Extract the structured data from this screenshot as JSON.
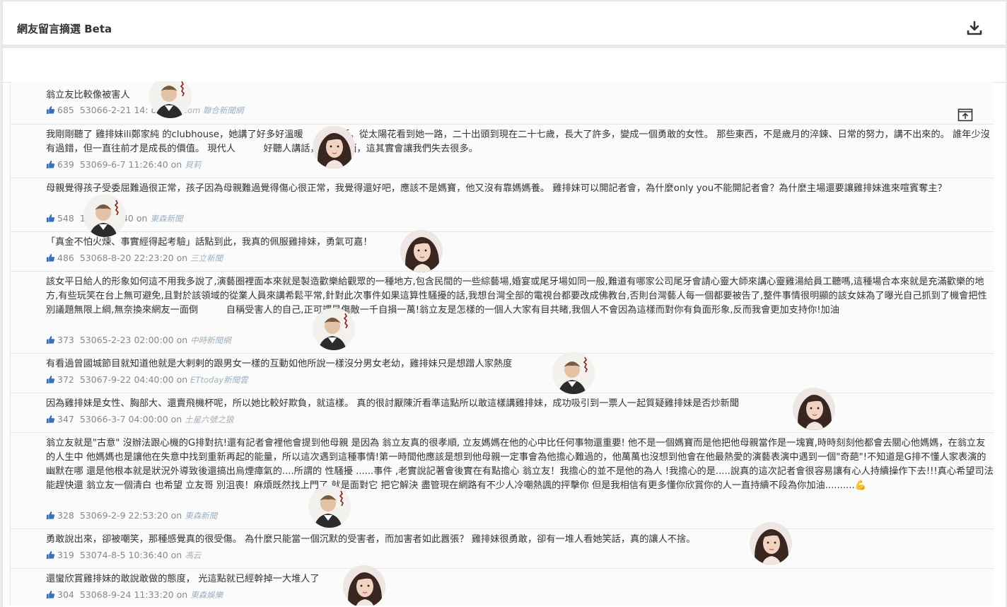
{
  "header": {
    "title": "網友留言摘選 Beta",
    "download_icon": "download-icon"
  },
  "comments": [
    {
      "text": "翁立友比較像被害人",
      "likes": "685",
      "time": "53066-2-21 14:",
      "on": "on",
      "source": "udn.com 聯合新聞網",
      "avatar": "man"
    },
    {
      "text": "我剛剛聽了 雞排妹ili鄭家純 的clubhouse，她講了好多好溫暖　　　的話。從太陽花看到她一路，二十出頭到現在二十七歲，長大了許多，變成一個勇敢的女性。 那些東西，不是歲月的淬鍊、日常的努力，講不出來的。 誰年少沒有過錯，但一直往前才是成長的價值。 現代人　　　好聽人講話，只求片面，這其實會讓我們失去很多。",
      "likes": "639",
      "time": "53069-6-7 11:26:40",
      "on": "on",
      "source": "貝莉",
      "avatar": "woman"
    },
    {
      "text": "母親覺得孩子受委屈難過很正常，孩子因為母親難過覺得傷心很正常，我覺得還好吧，應該不是媽寶，他又沒有靠媽媽養。 雞排妹可以開記者會，為什麼only you不能開記者會？為什麼主場還要讓雞排妹進來喧賓奪主？",
      "likes": "548",
      "time": "16 23:46:40",
      "on": "on",
      "source": "東森新聞",
      "avatar": "man"
    },
    {
      "text": "「真金不怕火煉、事實經得起考驗」話點到此，我真的佩服雞排妹，勇氣可嘉！",
      "likes": "486",
      "time": "53068-8-20 22:23:20",
      "on": "on",
      "source": "三立新聞",
      "avatar": "woman"
    },
    {
      "text": "該女平日給人的形象如何這不用我多說了,演藝圈裡面本來就是製造歡樂給觀眾的一種地方,包含民間的一些綜藝場,婚宴或尾牙場如同一般,難道有哪家公司尾牙會請心靈大師來講心靈雞湯給員工聽嗎,這種場合本來就是充滿歡樂的地方,有些玩笑在台上無可避免,且對於該領域的從業人員來講希鬆平常,針對此次事件如果這算性騷擾的話,我想台灣全部的電視台都要改成佛教台,否則台灣藝人每一個都要被告了,整件事情很明顯的該女妹為了曝光自己抓到了機會把性別議題無限上綱,無奈換來網友一面倒　　　自稱受害人的自己,正可謂是傷敵一千自損一萬!翁立友是怎樣的一個人大家有目共睹,我個人不會因為這樣而對你有負面形象,反而我會更加支持你!加油",
      "likes": "373",
      "time": "53065-2-23 02:00:00",
      "on": "on",
      "source": "中時新聞網",
      "avatar": "man"
    },
    {
      "text": "有看過曾國城節目就知道他就是大剌剌的跟男女一樣的互動如他所說一樣沒分男女老幼，雞排妹只是想蹭人家熱度",
      "likes": "372",
      "time": "53067-9-22 04:40:00",
      "on": "on",
      "source": "ETtoday新聞雲",
      "avatar": "man"
    },
    {
      "text": "因為雞排妹是女性、胸部大、還賣飛機杯呢，所以她比較好欺負，就這樣。 真的很討厭陳沂看準這點所以敢這樣講雞排妹，成功吸引到一票人一起質疑雞排妹是否炒新聞",
      "likes": "347",
      "time": "53066-3-7 04:00:00",
      "on": "on",
      "source": "土星六號之狼",
      "avatar": "woman"
    },
    {
      "text": "翁立友就是\"古意\" 沒辦法跟心機的G排對抗!還有記者會裡他會提到他母親 是因為 翁立友真的很孝順, 立友媽媽在他的心中比任何事物還重要! 他不是一個媽寶而是他把他母親當作是一塊寶,時時刻刻他都會去關心他媽媽，在翁立友的人生中 他媽媽也是讓他在失意中找到重新再起的能量，所以這次遇到這種事情!第一時間他應該是想到他母親一定事會為他擔心難過的，他萬萬也沒想到他會在他最熱愛的演藝表演中遇到一個\"奇葩\"!不知道是G排不懂人家表演的幽默在哪 還是他根本就是狀況外導致後還搞出烏煙瘴氣的....所謂的 性騷擾 ......事件 ,老實說記著會後實在有點擔心 翁立友！我擔心的並不是他的為人 !我擔心的是.....說真的這次記者會很容易讓有心人持續操作下去!!!真心希望司法能趕快還 翁立友一個清白 也希望 立友哥 別沮喪！麻煩既然找上門了 就是面對它 把它解決 盡管現在網路有不少人冷嘲熱諷的抨擊你 但是我相信有更多懂你欣賞你的人一直持續不段為你加油..........💪",
      "likes": "328",
      "time": "53069-2-9 22:53:20",
      "on": "on",
      "source": "東森新聞",
      "avatar": "man"
    },
    {
      "text": "勇敢說出來，卻被嘲笑，那種感覺真的很受傷。 為什麼只能當一個沉默的受害者，而加害者如此囂張？ 雞排妹很勇敢，卻有一堆人看她笑話，真的讓人不捨。",
      "likes": "319",
      "time": "53074-8-5 10:36:40",
      "on": "on",
      "source": "馮云",
      "avatar": "woman"
    },
    {
      "text": "還蠻欣賞雞排妹的敢說敢做的態度， 光這點就已經幹掉一大堆人了",
      "likes": "304",
      "time": "53068-9-24 11:33:20",
      "on": "on",
      "source": "東森娛樂",
      "avatar": "woman"
    }
  ]
}
